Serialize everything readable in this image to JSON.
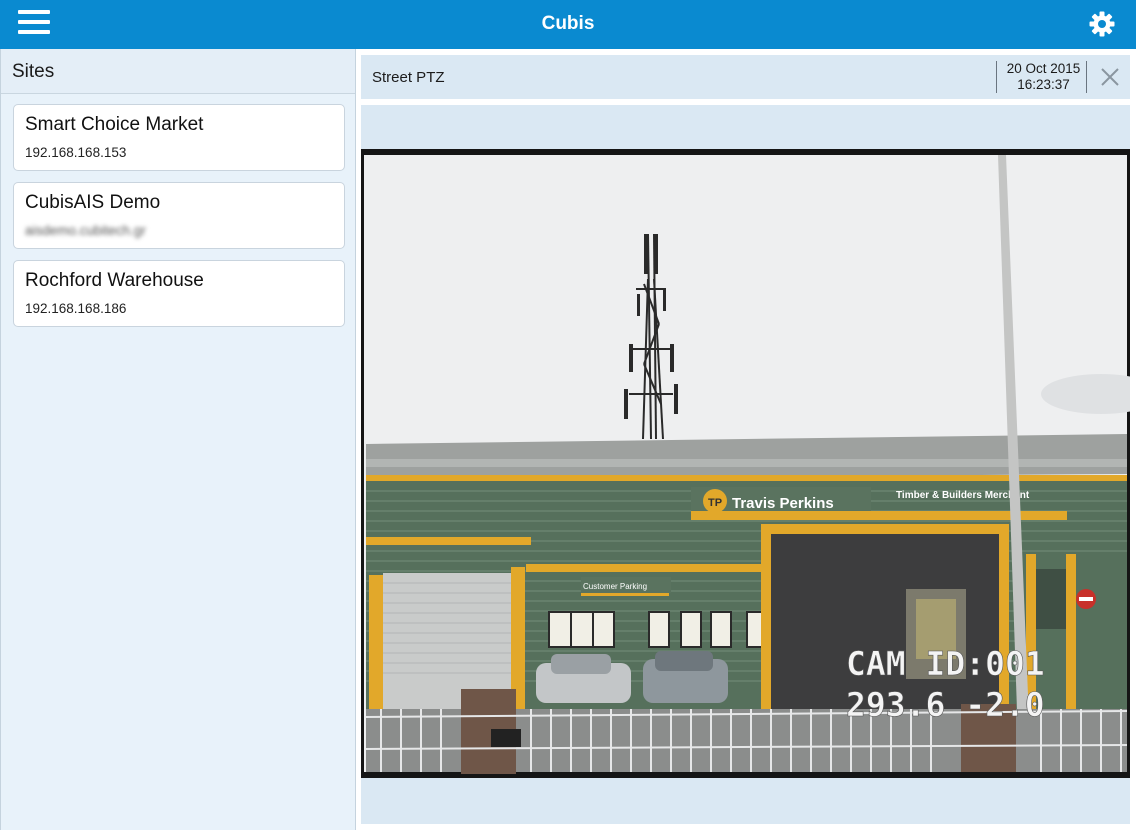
{
  "app": {
    "title": "Cubis"
  },
  "sidebar": {
    "header": "Sites",
    "sites": [
      {
        "name": "Smart Choice Market",
        "host": "192.168.168.153"
      },
      {
        "name": "CubisAIS Demo",
        "host": "aisdemo.cubitech.gr"
      },
      {
        "name": "Rochford Warehouse",
        "host": "192.168.168.186"
      }
    ]
  },
  "camera": {
    "name": "Street PTZ",
    "date": "20 Oct 2015",
    "time": "16:23:37",
    "overlay": {
      "cam_id": "CAM ID:001",
      "ptz": "293.6 -2.0"
    },
    "scene": {
      "sign_main": "Travis Perkins",
      "sign_sub": "Timber & Builders Merchant",
      "sign_small": "Customer Parking"
    }
  },
  "colors": {
    "accent": "#0a8ad0",
    "panel": "#dae8f3",
    "sidebar_bg": "#e8f2fa"
  }
}
